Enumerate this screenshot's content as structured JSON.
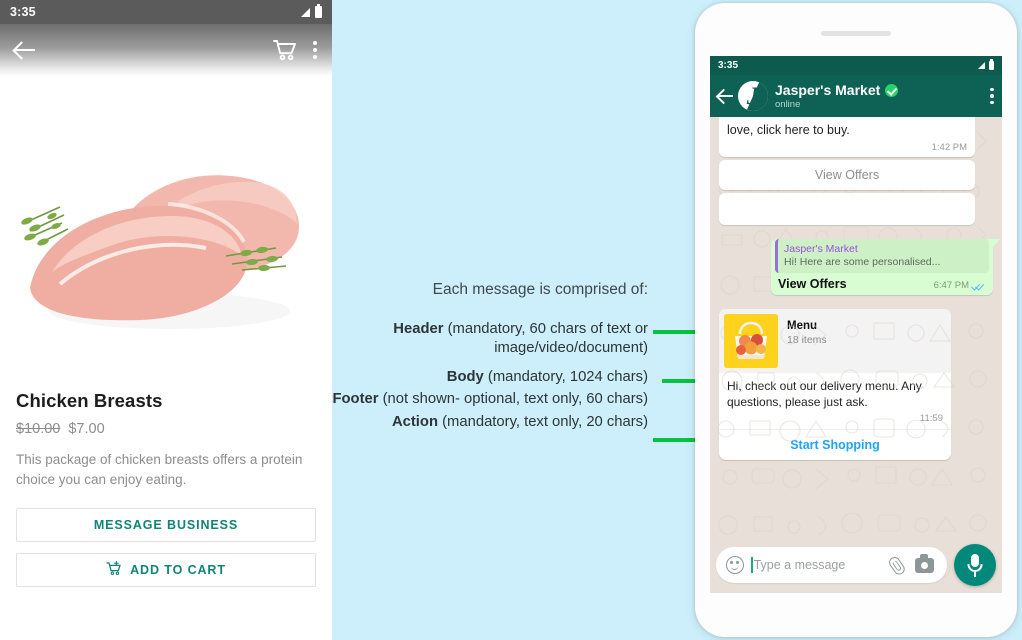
{
  "left_phone": {
    "status_bar": {
      "time": "3:35",
      "signal_icon": "signal-triangle-icon",
      "battery_icon": "battery-icon"
    },
    "app_bar": {
      "back_icon": "back-arrow-icon",
      "cart_icon": "shopping-cart-icon",
      "overflow_icon": "more-vertical-icon"
    },
    "product": {
      "image_alt": "chicken-breasts-photo",
      "title": "Chicken Breasts",
      "price_old": "$10.00",
      "price_new": "$7.00",
      "description": "This package of chicken breasts offers a protein choice you can enjoy eating.",
      "buttons": [
        {
          "label": "MESSAGE BUSINESS",
          "icon": null
        },
        {
          "label": "ADD TO CART",
          "icon": "add-to-cart-icon"
        }
      ]
    }
  },
  "annotations": {
    "heading": "Each message is comprised of:",
    "rows": [
      {
        "term": "Header",
        "detail": "(mandatory, 60 chars of text or image/video/document)",
        "has_connector": true
      },
      {
        "term": "Body",
        "detail": "(mandatory, 1024 chars)",
        "has_connector": true
      },
      {
        "term": "Footer",
        "detail": "(not shown- optional, text only, 60 chars)",
        "has_connector": false
      },
      {
        "term": "Action",
        "detail": "(mandatory, text only, 20 chars)",
        "has_connector": true
      }
    ],
    "connector_color": "#07c23e"
  },
  "right_phone": {
    "status_bar": {
      "time": "3:35"
    },
    "chat_header": {
      "back_icon": "back-arrow-icon",
      "avatar_letter": "J",
      "contact_name": "Jasper's Market",
      "verified_icon": "verified-badge-icon",
      "status": "online",
      "overflow_icon": "more-vertical-icon"
    },
    "messages": {
      "incoming_top": {
        "text": "love, click here to buy.",
        "time": "1:42 PM",
        "action_label": "View Offers"
      },
      "outgoing": {
        "quote_name": "Jasper's Market",
        "quote_text": "Hi! Here are some personalised...",
        "action_label": "View Offers",
        "time": "6:47 PM",
        "read_receipt_icon": "double-check-icon"
      },
      "card": {
        "thumb_alt": "fruit-basket-thumbnail",
        "title": "Menu",
        "subtitle": "18 items",
        "body": "Hi, check out our delivery menu. Any questions, please just ask.",
        "time": "11:59",
        "action_label": "Start Shopping"
      }
    },
    "composer": {
      "emoji_icon": "emoji-icon",
      "placeholder": "Type a message",
      "attach_icon": "paperclip-icon",
      "camera_icon": "camera-icon",
      "mic_icon": "microphone-icon"
    }
  },
  "colors": {
    "page_background": "#cdeefb",
    "whatsapp_header": "#0d6155",
    "accent_green": "#07c23e",
    "teal_button": "#0f8478",
    "link_blue": "#1fa5f3"
  }
}
